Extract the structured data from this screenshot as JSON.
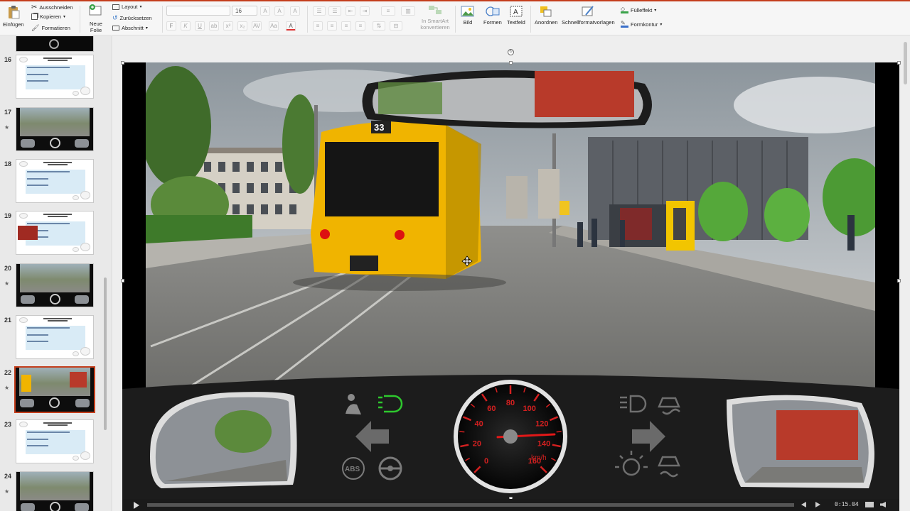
{
  "ribbon": {
    "paste": "Einfügen",
    "cut": "Ausschneiden",
    "copy": "Kopieren",
    "format_painter": "Formatieren",
    "new_slide": "Neue Folie",
    "layout": "Layout",
    "reset": "Zurücksetzen",
    "section": "Abschnitt",
    "font_name": "",
    "font_size": "16",
    "smartart": "In SmartArt konvertieren",
    "picture": "Bild",
    "shapes": "Formen",
    "textbox": "Textfeld",
    "arrange": "Anordnen",
    "quick_styles": "Schnellformatvorlagen",
    "fill": "Fülleffekt",
    "outline": "Formkontur"
  },
  "slides": [
    {
      "num": "16",
      "star": "",
      "kind": "question"
    },
    {
      "num": "17",
      "star": "★",
      "kind": "video"
    },
    {
      "num": "18",
      "star": "",
      "kind": "question"
    },
    {
      "num": "19",
      "star": "",
      "kind": "question-img"
    },
    {
      "num": "20",
      "star": "★",
      "kind": "video"
    },
    {
      "num": "21",
      "star": "",
      "kind": "question"
    },
    {
      "num": "22",
      "star": "★",
      "kind": "video",
      "selected": true
    },
    {
      "num": "23",
      "star": "",
      "kind": "question"
    },
    {
      "num": "24",
      "star": "★",
      "kind": "video"
    }
  ],
  "video": {
    "tram_route": "33",
    "speed_unit": "km/h",
    "speed_ticks": [
      "0",
      "20",
      "40",
      "60",
      "80",
      "100",
      "120",
      "140",
      "160"
    ],
    "speed_kmh": 25,
    "abs_label": "ABS",
    "playback_fraction": 0.0,
    "time": "0:15.04"
  },
  "colors": {
    "accent": "#c43e1c",
    "dash": "#1c1c1c",
    "tram": "#f0b400"
  }
}
